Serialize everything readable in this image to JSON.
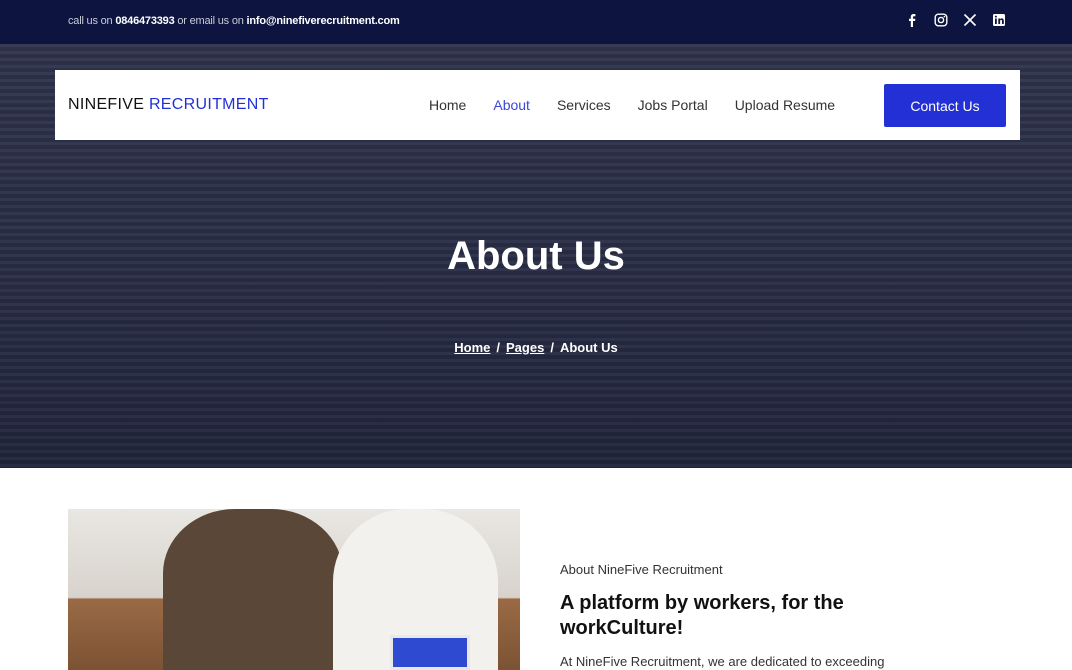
{
  "topbar": {
    "contact_prefix": "call us on ",
    "phone": "0846473393",
    "contact_mid": " or email us on ",
    "email": "info@ninefiverecruitment.com",
    "socials": [
      "facebook-icon",
      "instagram-icon",
      "x-icon",
      "linkedin-icon"
    ]
  },
  "logo": {
    "part1": "NINEFIVE ",
    "part2": "RECRUITMENT"
  },
  "nav": {
    "items": [
      "Home",
      "About",
      "Services",
      "Jobs Portal",
      "Upload Resume"
    ],
    "active": "About",
    "cta": "Contact Us"
  },
  "hero": {
    "title": "About Us",
    "breadcrumb": [
      "Home",
      "Pages",
      "About Us"
    ],
    "separator": "/"
  },
  "about": {
    "kicker": "About NineFive Recruitment",
    "heading": "A platform by workers, for the workCulture!",
    "text": "At NineFive Recruitment, we are dedicated to exceeding"
  },
  "colors": {
    "topbar": "#0d1440",
    "accent": "#2330d6",
    "active_link": "#3a47d9"
  }
}
